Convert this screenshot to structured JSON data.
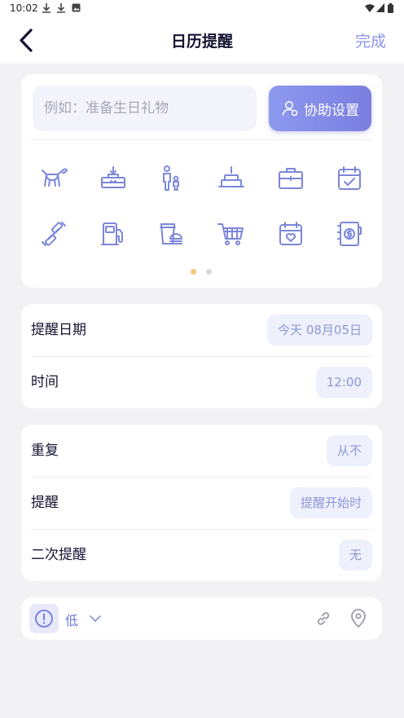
{
  "status_bar": {
    "time": "10:02"
  },
  "header": {
    "title": "日历提醒",
    "done_label": "完成"
  },
  "note": {
    "placeholder": "例如：准备生日礼物",
    "assist_label": "协助设置"
  },
  "category_icons": [
    "dog-icon",
    "gift-box-icon",
    "parent-child-icon",
    "birthday-cake-icon",
    "briefcase-icon",
    "calendar-check-icon",
    "dumbbell-icon",
    "fuel-pump-icon",
    "coffee-burger-icon",
    "shopping-cart-icon",
    "calendar-heart-icon",
    "notebook-dollar-icon"
  ],
  "pager": {
    "pages": 2,
    "active": 0
  },
  "date_card": {
    "rows": [
      {
        "label": "提醒日期",
        "value": "今天 08月05日"
      },
      {
        "label": "时间",
        "value": "12:00"
      }
    ]
  },
  "repeat_card": {
    "rows": [
      {
        "label": "重复",
        "value": "从不"
      },
      {
        "label": "提醒",
        "value": "提醒开始时"
      },
      {
        "label": "二次提醒",
        "value": "无"
      }
    ]
  },
  "priority": {
    "label": "低"
  },
  "colors": {
    "accent": "#8d97e8",
    "icon": "#7c87da",
    "dot_active": "#f5c97b"
  }
}
